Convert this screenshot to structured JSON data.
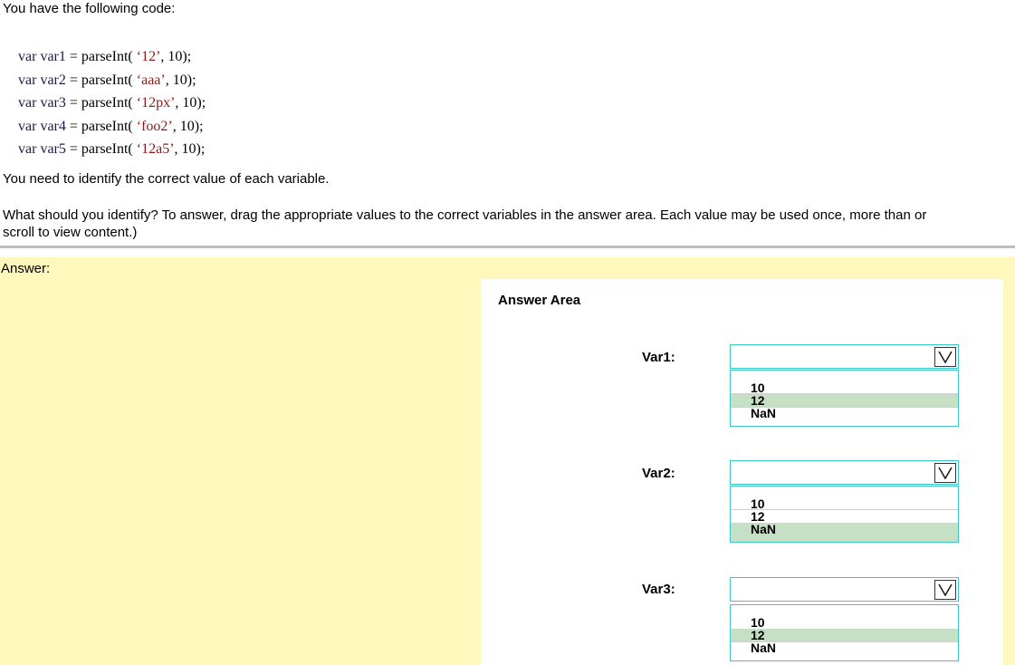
{
  "question": {
    "intro": "You have the following code:",
    "code_lines": [
      {
        "kw": "var",
        "name": "var1",
        "mid": " = parseInt( ",
        "str": "‘12’",
        "end": ", 10);"
      },
      {
        "kw": "var",
        "name": "var2",
        "mid": " = parseInt( ",
        "str": "‘aaa’",
        "end": ", 10);"
      },
      {
        "kw": "var",
        "name": "var3",
        "mid": " = parseInt( ",
        "str": "‘12px’",
        "end": ", 10);"
      },
      {
        "kw": "var",
        "name": "var4",
        "mid": " = parseInt( ",
        "str": "‘foo2’",
        "end": ", 10);"
      },
      {
        "kw": "var",
        "name": "var5",
        "mid": " = parseInt( ",
        "str": "‘12a5’",
        "end": ", 10);"
      }
    ],
    "need": "You need to identify the correct value of each variable.",
    "what_line1": "What should you identify? To answer, drag the appropriate values to the correct variables in the answer area. Each value may be used once, more than or",
    "what_line2": "scroll to view content.)"
  },
  "answer": {
    "label": "Answer:",
    "area_title": "Answer Area",
    "items": [
      {
        "label": "Var1:",
        "options": [
          "10",
          "12",
          "NaN"
        ],
        "selected": "12"
      },
      {
        "label": "Var2:",
        "options": [
          "10",
          "12",
          "NaN"
        ],
        "selected": "NaN"
      },
      {
        "label": "Var3:",
        "options": [
          "10",
          "12",
          "NaN"
        ],
        "selected": "12"
      }
    ]
  }
}
